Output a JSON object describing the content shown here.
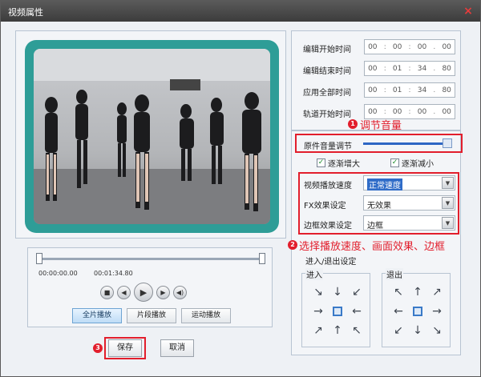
{
  "window": {
    "title": "视频属性",
    "close_glyph": "×"
  },
  "timing": {
    "rows": [
      {
        "label": "编辑开始时间",
        "hh": "00",
        "mm": "00",
        "ss": "00",
        "ff": "00"
      },
      {
        "label": "编辑结束时间",
        "hh": "00",
        "mm": "01",
        "ss": "34",
        "ff": "80"
      },
      {
        "label": "应用全部时间",
        "hh": "00",
        "mm": "01",
        "ss": "34",
        "ff": "80"
      },
      {
        "label": "轨道开始时间",
        "hh": "00",
        "mm": "00",
        "ss": "00",
        "ff": "00"
      }
    ]
  },
  "volume": {
    "label": "原件音量调节",
    "level": 0.95
  },
  "checkboxes": {
    "fade_in": "逐渐增大",
    "fade_out": "逐渐减小",
    "fade_in_checked": true,
    "fade_out_checked": true
  },
  "settings": {
    "speed_label": "视频播放速度",
    "speed_value": "正常速度",
    "fx_label": "FX效果设定",
    "fx_value": "无效果",
    "border_label": "边框效果设定",
    "border_value": "边框"
  },
  "transitions": {
    "title": "进入/退出设定",
    "enter_label": "进入",
    "exit_label": "退出"
  },
  "player": {
    "time_start": "00:00:00.00",
    "time_end": "00:01:34.80",
    "modes": [
      "全片播放",
      "片段播放",
      "运动播放"
    ],
    "active_mode": 0
  },
  "buttons": {
    "save": "保存",
    "cancel": "取消"
  },
  "callouts": {
    "c1_num": "1",
    "c1_text": "调节音量",
    "c2_num": "2",
    "c2_text": "选择播放速度、画面效果、边框",
    "c3_num": "3"
  },
  "colors": {
    "accent_red": "#e21e2c",
    "frame_teal": "#2e9d97",
    "volume_blue": "#2d66c4"
  }
}
